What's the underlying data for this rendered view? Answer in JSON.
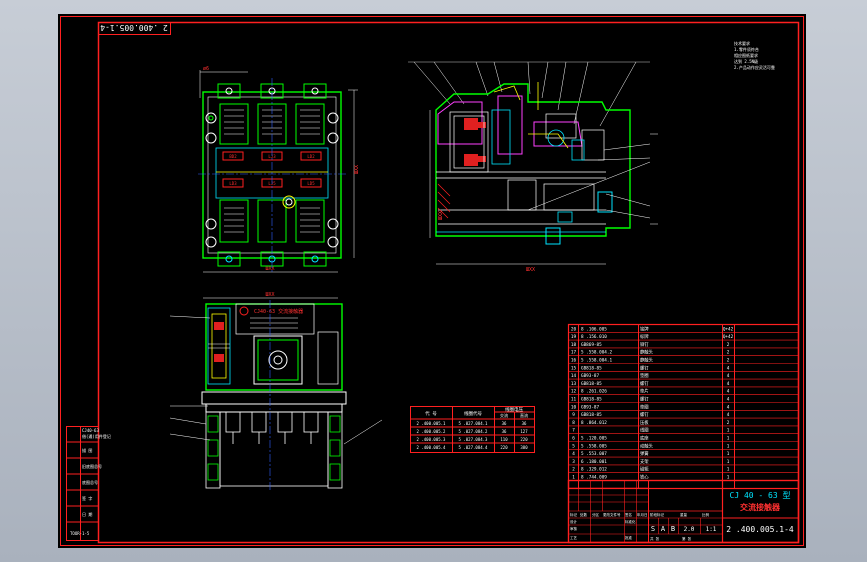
{
  "drawing": {
    "stamp_top": "2 .400.005.1-4",
    "drawing_number": "2 .400.005.1-4",
    "title_line1": "CJ 40 - 63 型",
    "title_line2": "交流接触器",
    "scale": "1:1",
    "sheet": "2.0",
    "stage_marks": [
      "S",
      "A",
      "B"
    ],
    "left_strip": [
      "CJ40-63",
      "借(通)用件登记",
      "描 图",
      "旧底图总号",
      "底图总号",
      "签 字",
      "日 期",
      "TOOR-1-5"
    ],
    "panel_labels": [
      "BD2",
      "LJ3",
      "LD2",
      "LD3",
      "LJ5",
      "LD5"
    ],
    "nameplate": "CJ40-63 交流接触器",
    "notes": [
      "技术要求",
      "1.零件须符合",
      "  相应图纸要求",
      "  达到 2.5N级",
      "2.产品动作应灵活可靠"
    ],
    "dims": {
      "top_view_width": "ШХХ",
      "side_view": "ШХХ",
      "front_view": "ШХХ"
    },
    "variant_table": {
      "headers": [
        "代 号",
        "线圈代号",
        "线圈电压"
      ],
      "subheaders": [
        "",
        "",
        "交流",
        "直流"
      ],
      "rows": [
        [
          "2 .400.005.1",
          "5 .027.084.1",
          "36",
          "36"
        ],
        [
          "2 .400.005.2",
          "5 .027.084.2",
          "36",
          "127"
        ],
        [
          "2 .400.005.3",
          "5 .027.084.3",
          "110",
          "220"
        ],
        [
          "2 .400.005.4",
          "5 .027.084.4",
          "220",
          "380"
        ]
      ]
    },
    "bom": [
      [
        "20",
        "8 .106.005",
        "铭牌",
        "Q+42"
      ],
      [
        "19",
        "8 .156.010",
        "标牌",
        "Q+42"
      ],
      [
        "18",
        "GB869-85",
        "铆钉",
        "2"
      ],
      [
        "17",
        "5 .558.004.2",
        "静触头",
        "2"
      ],
      [
        "16",
        "5 .558.004.1",
        "静触头",
        "2"
      ],
      [
        "15",
        "GB818-85",
        "螺钉",
        "4"
      ],
      [
        "14",
        "GB93-87",
        "垫圈",
        "4"
      ],
      [
        "13",
        "GB818-85",
        "螺钉",
        "4"
      ],
      [
        "12",
        "8 .261.026",
        "垫片",
        "4"
      ],
      [
        "11",
        "GB818-85",
        "螺钉",
        "4"
      ],
      [
        "10",
        "GB93-87",
        "垫圈",
        "4"
      ],
      [
        "9",
        "GB818-85",
        "螺钉",
        "4"
      ],
      [
        "8",
        "8 .864.012",
        "压板",
        "2"
      ],
      [
        "7",
        "",
        "线圈",
        "1"
      ],
      [
        "6",
        "5 .120.005",
        "底座",
        "1"
      ],
      [
        "5",
        "5 .558.005",
        "动触头",
        "1"
      ],
      [
        "4",
        "5 .553.007",
        "弹簧",
        "1"
      ],
      [
        "3",
        "6 .180.001",
        "支架",
        "1"
      ],
      [
        "2",
        "8 .329.012",
        "磁轭",
        "1"
      ],
      [
        "1",
        "8 .744.009",
        "铁心",
        "1"
      ]
    ],
    "title_block": [
      "标记",
      "处数",
      "分区",
      "更改文件号",
      "签名",
      "年月日",
      "设计",
      "标准化",
      "阶段标记",
      "重量",
      "比例",
      "审核",
      "工艺",
      "批准",
      "共 张",
      "第 张"
    ]
  }
}
